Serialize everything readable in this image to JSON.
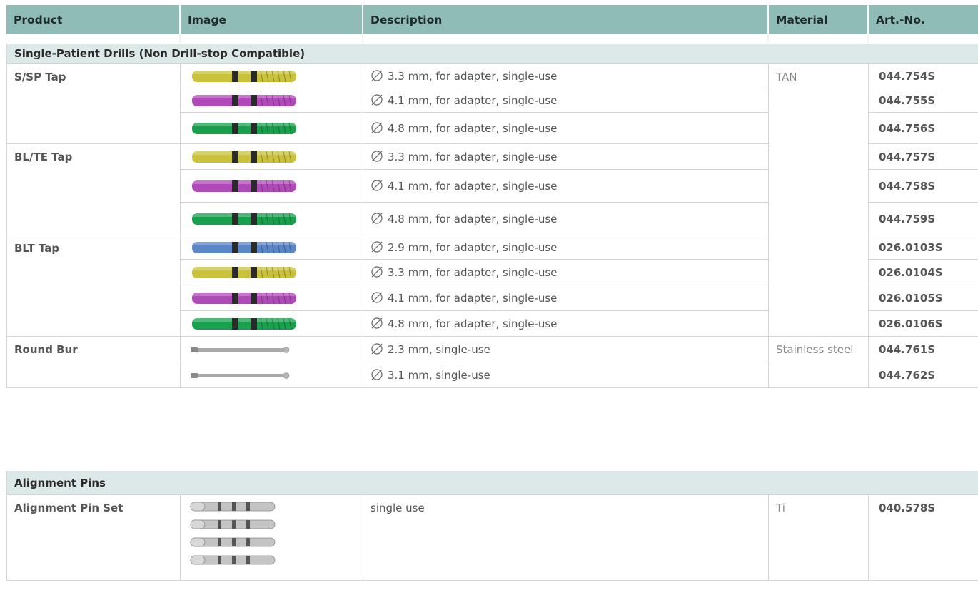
{
  "header": {
    "product": "Product",
    "image": "Image",
    "description": "Description",
    "material": "Material",
    "art_no": "Art.-No."
  },
  "sections": [
    {
      "title": "Single-Patient Drills (Non Drill-stop Compatible)",
      "groups": [
        {
          "product": "S/SP Tap",
          "rows": [
            {
              "color": "#c9c23a",
              "tool": "tap",
              "description": "3.3 mm, for adapter, single-use",
              "art_no": "044.754S"
            },
            {
              "color": "#b04ab8",
              "tool": "tap",
              "description": "4.1 mm, for adapter, single-use",
              "art_no": "044.755S"
            },
            {
              "color": "#18a04c",
              "tool": "tap",
              "description": "4.8 mm, for adapter, single-use",
              "art_no": "044.756S"
            }
          ]
        },
        {
          "product": "BL/TE Tap",
          "rows": [
            {
              "color": "#c9c23a",
              "tool": "tap",
              "description": "3.3 mm, for adapter, single-use",
              "art_no": "044.757S"
            },
            {
              "color": "#b04ab8",
              "tool": "tap",
              "description": "4.1 mm, for adapter, single-use",
              "art_no": "044.758S"
            },
            {
              "color": "#18a04c",
              "tool": "tap",
              "description": "4.8 mm, for adapter, single-use",
              "art_no": "044.759S"
            }
          ]
        },
        {
          "product": "BLT Tap",
          "rows": [
            {
              "color": "#5b86c8",
              "tool": "tap",
              "description": "2.9 mm, for adapter, single-use",
              "art_no": "026.0103S"
            },
            {
              "color": "#c9c23a",
              "tool": "tap",
              "description": "3.3 mm, for adapter, single-use",
              "art_no": "026.0104S"
            },
            {
              "color": "#b04ab8",
              "tool": "tap",
              "description": "4.1 mm, for adapter, single-use",
              "art_no": "026.0105S"
            },
            {
              "color": "#18a04c",
              "tool": "tap",
              "description": "4.8 mm, for adapter, single-use",
              "art_no": "026.0106S"
            }
          ]
        },
        {
          "product": "Round Bur",
          "rows": [
            {
              "color": "#a8a8a8",
              "tool": "bur",
              "description": "2.3 mm, single-use",
              "art_no": "044.761S"
            },
            {
              "color": "#a8a8a8",
              "tool": "bur",
              "description": "3.1 mm, single-use",
              "art_no": "044.762S"
            }
          ]
        }
      ],
      "materials": [
        "TAN",
        "Stainless steel"
      ]
    },
    {
      "title": "Alignment Pins",
      "product": "Alignment Pin Set",
      "description": "single use",
      "material": "Ti",
      "art_no": "040.578S"
    }
  ],
  "icons": {
    "diameter": "diameter-icon"
  }
}
